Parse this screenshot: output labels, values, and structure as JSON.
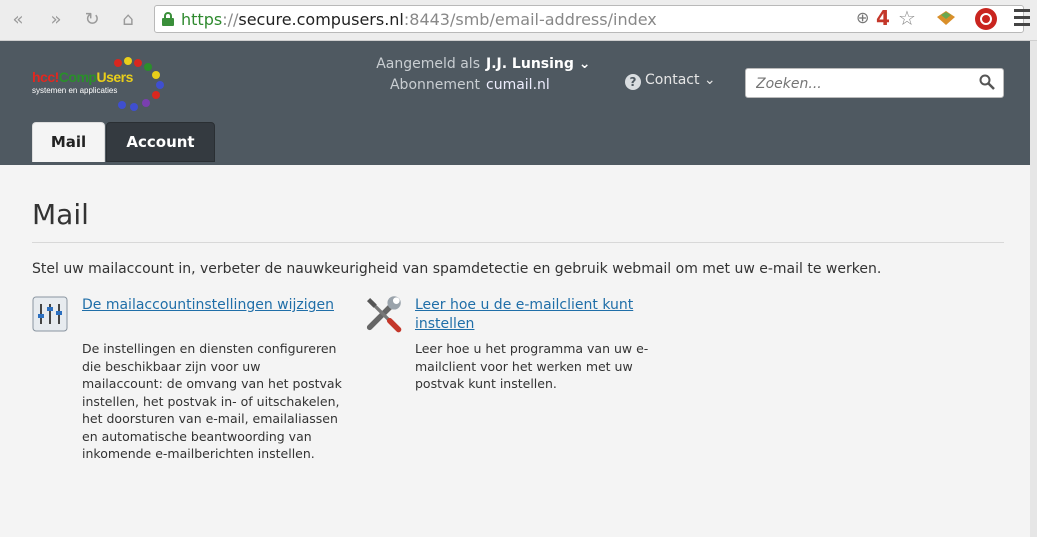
{
  "browser": {
    "url_scheme": "https",
    "url_sep": "://",
    "url_host": "secure.compusers.nl",
    "url_rest": ":8443/smb/email-address/index",
    "badge": "4"
  },
  "header": {
    "logo_name_1": "hcc!",
    "logo_name_2": "Comp",
    "logo_name_3": "Users",
    "logo_tagline": "systemen en applicaties",
    "signed_in_label": "Aangemeld als",
    "signed_in_user": "J.J. Lunsing",
    "subscription_label": "Abonnement",
    "subscription_value": "cumail.nl",
    "contact_label": "Contact",
    "search_placeholder": "Zoeken...",
    "tabs": [
      {
        "label": "Mail"
      },
      {
        "label": "Account"
      }
    ]
  },
  "main": {
    "title": "Mail",
    "intro": "Stel uw mailaccount in, verbeter de nauwkeurigheid van spamdetectie en gebruik webmail om met uw e-mail te werken.",
    "cards": [
      {
        "link": "De mailaccountinstellingen wijzigen",
        "description": "De instellingen en diensten configureren die beschikbaar zijn voor uw mailaccount: de omvang van het postvak instellen, het postvak in- of uitschakelen, het doorsturen van e-mail, emailaliassen en automatische beantwoording van inkomende e-mailberichten instellen.",
        "icon": "settings-sliders-icon"
      },
      {
        "link": "Leer hoe u de e-mailclient kunt instellen",
        "description": "Leer hoe u het programma van uw e-mailclient voor het werken met uw postvak kunt instellen.",
        "icon": "tools-icon"
      }
    ]
  }
}
